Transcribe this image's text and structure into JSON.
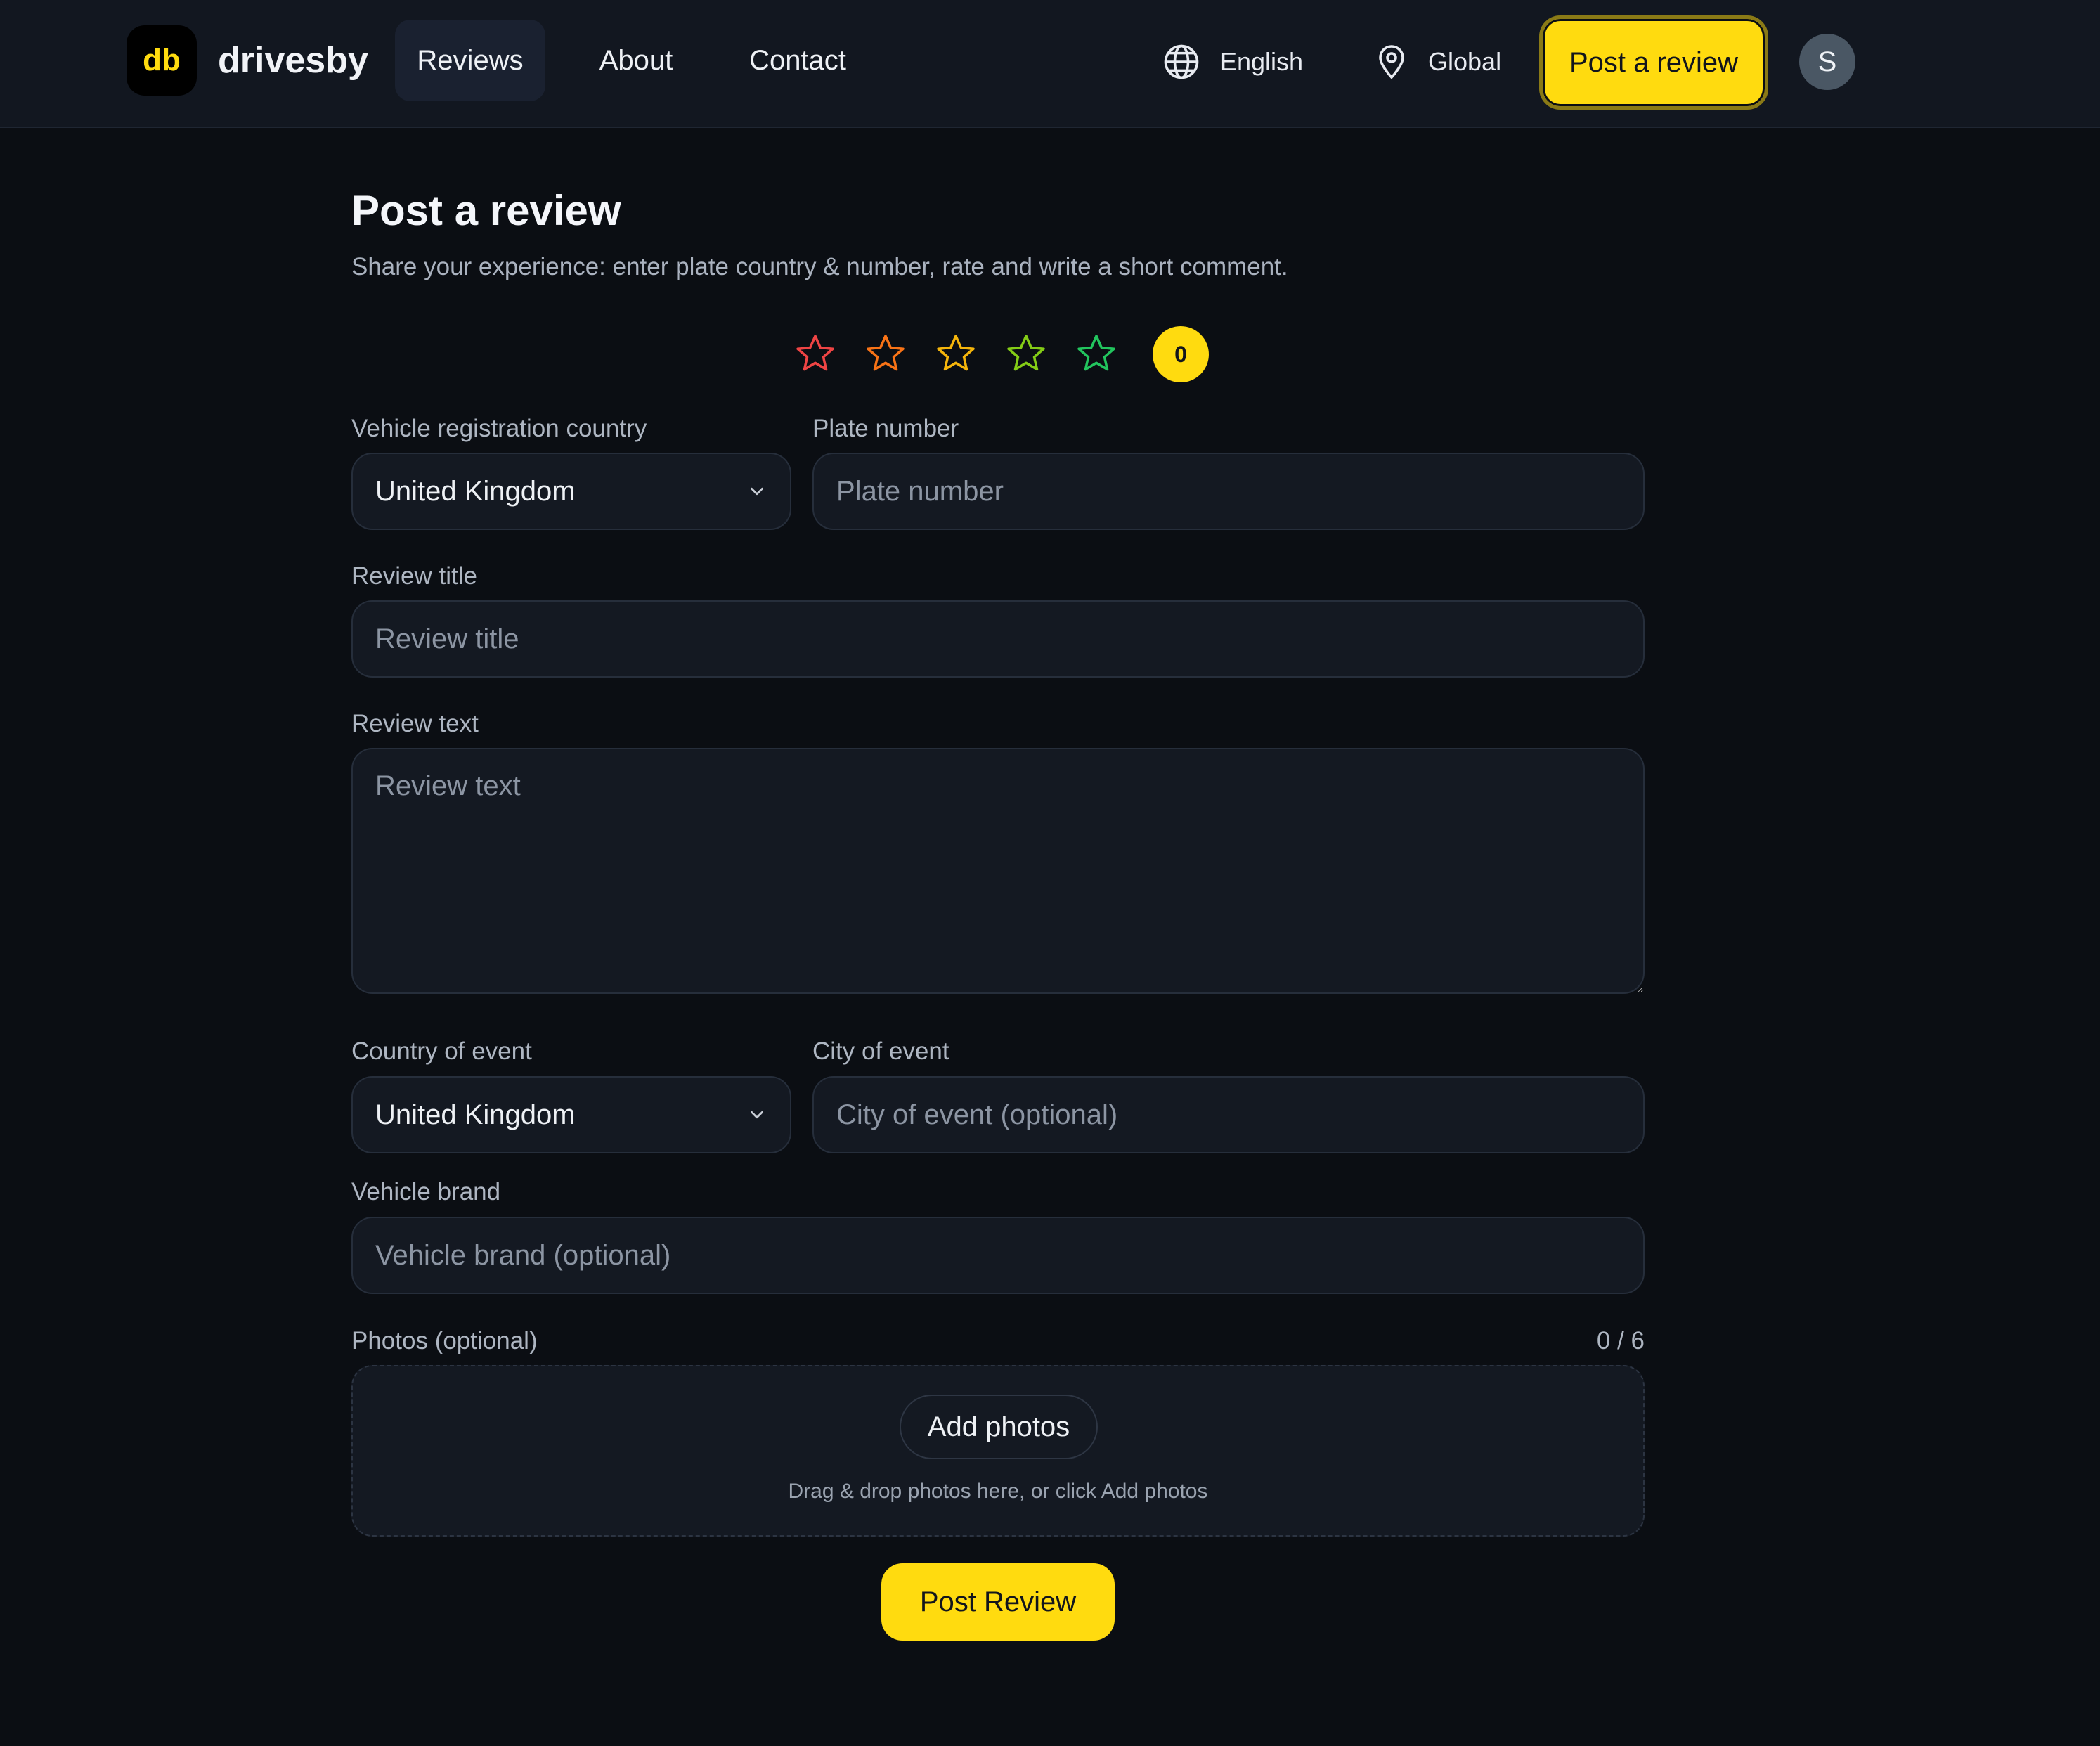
{
  "header": {
    "logo_text": "db",
    "brand": "drivesby",
    "nav": {
      "reviews": "Reviews",
      "about": "About",
      "contact": "Contact"
    },
    "language": "English",
    "region": "Global",
    "post_button": "Post a review",
    "avatar_initial": "S"
  },
  "page": {
    "title": "Post a review",
    "subtitle": "Share your experience: enter plate country & number, rate and write a short comment."
  },
  "rating": {
    "value": "0",
    "max": 5,
    "star_colors": [
      "#ef4444",
      "#f97316",
      "#f5b50b",
      "#84cc16",
      "#22c55e"
    ]
  },
  "form": {
    "reg_country_label": "Vehicle registration country",
    "reg_country_value": "United Kingdom",
    "plate_label": "Plate number",
    "plate_placeholder": "Plate number",
    "title_label": "Review title",
    "title_placeholder": "Review title",
    "text_label": "Review text",
    "text_placeholder": "Review text",
    "event_country_label": "Country of event",
    "event_country_value": "United Kingdom",
    "city_label": "City of event",
    "city_placeholder": "City of event (optional)",
    "brand_label": "Vehicle brand",
    "brand_placeholder": "Vehicle brand (optional)",
    "photos_label": "Photos (optional)",
    "photos_counter": "0 / 6",
    "add_photos": "Add photos",
    "drop_hint": "Drag & drop photos here, or click Add photos",
    "submit": "Post Review"
  },
  "colors": {
    "accent": "#ffdb0f",
    "background": "#0b0e13",
    "header": "#121720",
    "field": "#141922"
  },
  "icons": [
    "globe-icon",
    "location-pin-icon",
    "chevron-down-icon",
    "star-icon"
  ]
}
